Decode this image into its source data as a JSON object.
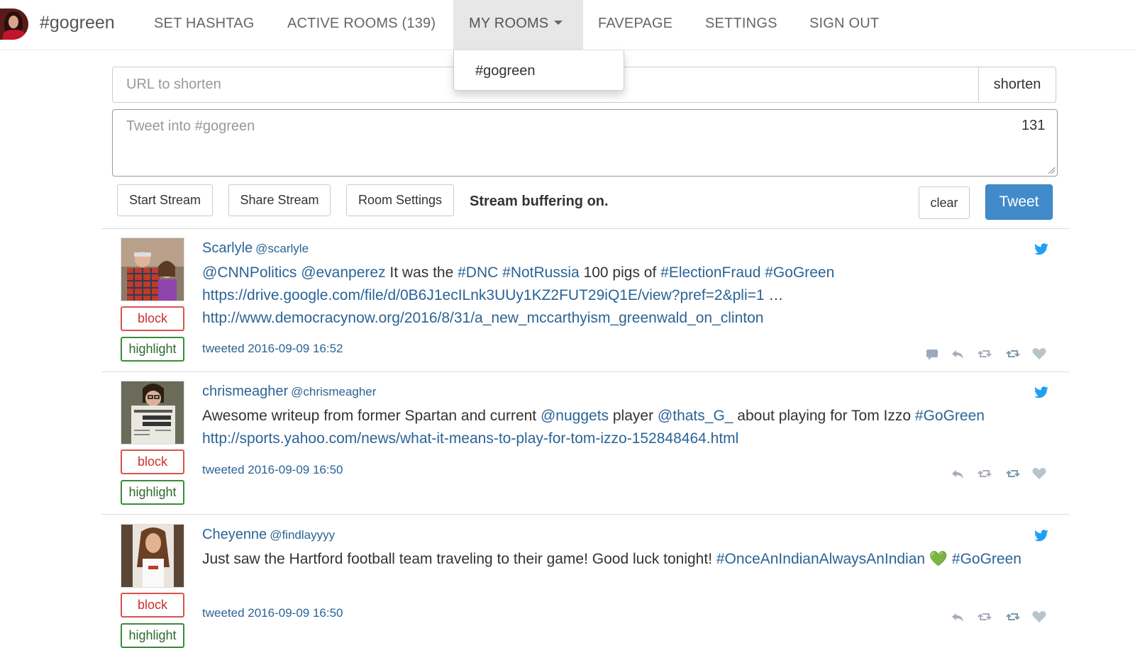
{
  "nav": {
    "brand": "#gogreen",
    "items": [
      "SET HASHTAG",
      "ACTIVE ROOMS (139)",
      "MY ROOMS",
      "FAVEPAGE",
      "SETTINGS",
      "SIGN OUT"
    ],
    "dropdown_item": "#gogreen"
  },
  "url": {
    "placeholder": "URL to shorten",
    "button": "shorten"
  },
  "composer": {
    "placeholder": "Tweet into #gogreen",
    "char_count": "131"
  },
  "controls": {
    "start_stream": "Start Stream",
    "share_stream": "Share Stream",
    "room_settings": "Room Settings",
    "status": "Stream buffering on.",
    "clear": "clear",
    "tweet": "Tweet"
  },
  "tweets": [
    {
      "name": "Scarlyle",
      "handle": "@scarlyle",
      "parts": [
        {
          "text": "@CNNPolitics",
          "link": true
        },
        {
          "text": " ",
          "link": false
        },
        {
          "text": "@evanperez",
          "link": true
        },
        {
          "text": " It was the ",
          "link": false
        },
        {
          "text": "#DNC",
          "link": true
        },
        {
          "text": " ",
          "link": false
        },
        {
          "text": "#NotRussia",
          "link": true
        },
        {
          "text": " 100 pigs of ",
          "link": false
        },
        {
          "text": "#ElectionFraud",
          "link": true
        },
        {
          "text": " ",
          "link": false
        },
        {
          "text": "#GoGreen",
          "link": true
        },
        {
          "text": " ",
          "link": false
        },
        {
          "text": "https://drive.google.com/file/d/0B6J1ecILnk3UUy1KZ2FUT29iQ1E/view?pref=2&pli=1",
          "link": true
        },
        {
          "text": " … ",
          "link": false
        },
        {
          "text": "http://www.democracynow.org/2016/8/31/a_new_mccarthyism_greenwald_on_clinton",
          "link": true
        }
      ],
      "time": "tweeted 2016-09-09 16:52",
      "block": "block",
      "highlight": "highlight"
    },
    {
      "name": "chrismeagher",
      "handle": "@chrismeagher",
      "parts": [
        {
          "text": "Awesome writeup from former Spartan and current ",
          "link": false
        },
        {
          "text": "@nuggets",
          "link": true
        },
        {
          "text": " player ",
          "link": false
        },
        {
          "text": "@thats_G_",
          "link": true
        },
        {
          "text": " about playing for Tom Izzo ",
          "link": false
        },
        {
          "text": "#GoGreen",
          "link": true
        },
        {
          "text": " ",
          "link": false
        },
        {
          "text": "http://sports.yahoo.com/news/what-it-means-to-play-for-tom-izzo-152848464.html",
          "link": true
        }
      ],
      "time": "tweeted 2016-09-09 16:50",
      "block": "block",
      "highlight": "highlight"
    },
    {
      "name": "Cheyenne",
      "handle": "@findlayyyy",
      "parts": [
        {
          "text": "Just saw the Hartford football team traveling to their game! Good luck tonight! ",
          "link": false
        },
        {
          "text": "#OnceAnIndianAlwaysAnIndian",
          "link": true
        },
        {
          "text": " 💚 ",
          "link": false
        },
        {
          "text": "#GoGreen",
          "link": true
        }
      ],
      "time": "tweeted 2016-09-09 16:50",
      "block": "block",
      "highlight": "highlight"
    }
  ],
  "colors": {
    "accent": "#428bca",
    "link": "#2a6496",
    "block": "#d9534f",
    "highlight": "#3c8a3c"
  }
}
